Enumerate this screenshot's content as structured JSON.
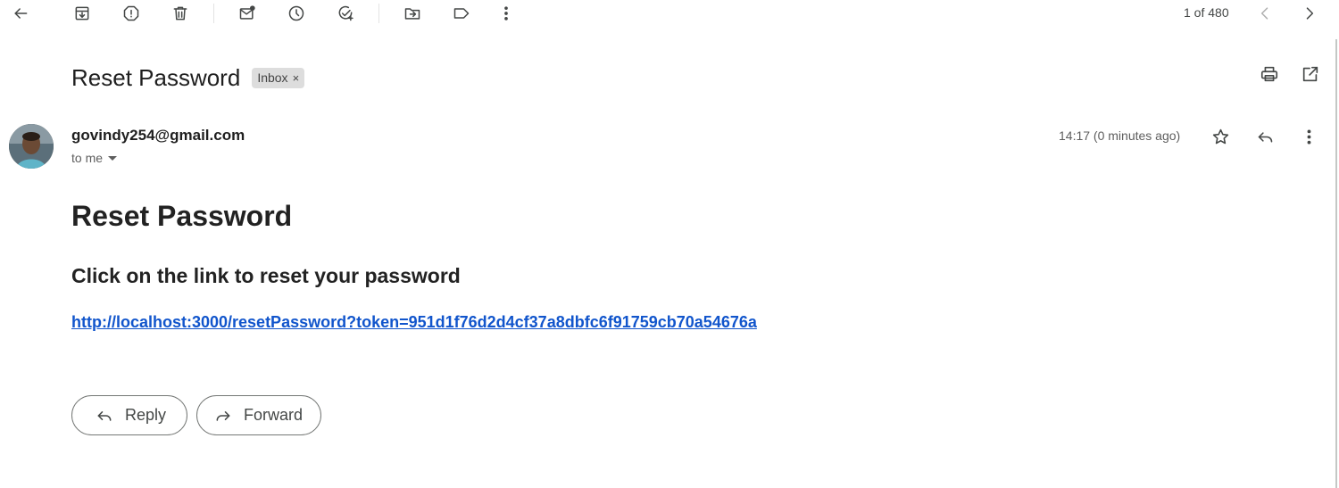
{
  "pager": {
    "text": "1 of 480"
  },
  "subject": "Reset Password",
  "label": {
    "name": "Inbox",
    "remove": "×"
  },
  "message": {
    "sender": "govindy254@gmail.com",
    "recipient": "to me",
    "timestamp": "14:17 (0 minutes ago)"
  },
  "body": {
    "heading": "Reset Password",
    "subheading": "Click on the link to reset your password",
    "link": "http://localhost:3000/resetPassword?token=951d1f76d2d4cf37a8dbfc6f91759cb70a54676a"
  },
  "actions": {
    "reply": "Reply",
    "forward": "Forward"
  },
  "colors": {
    "link": "#1155cc",
    "chip_bg": "#dddddd",
    "icon": "#444746"
  }
}
